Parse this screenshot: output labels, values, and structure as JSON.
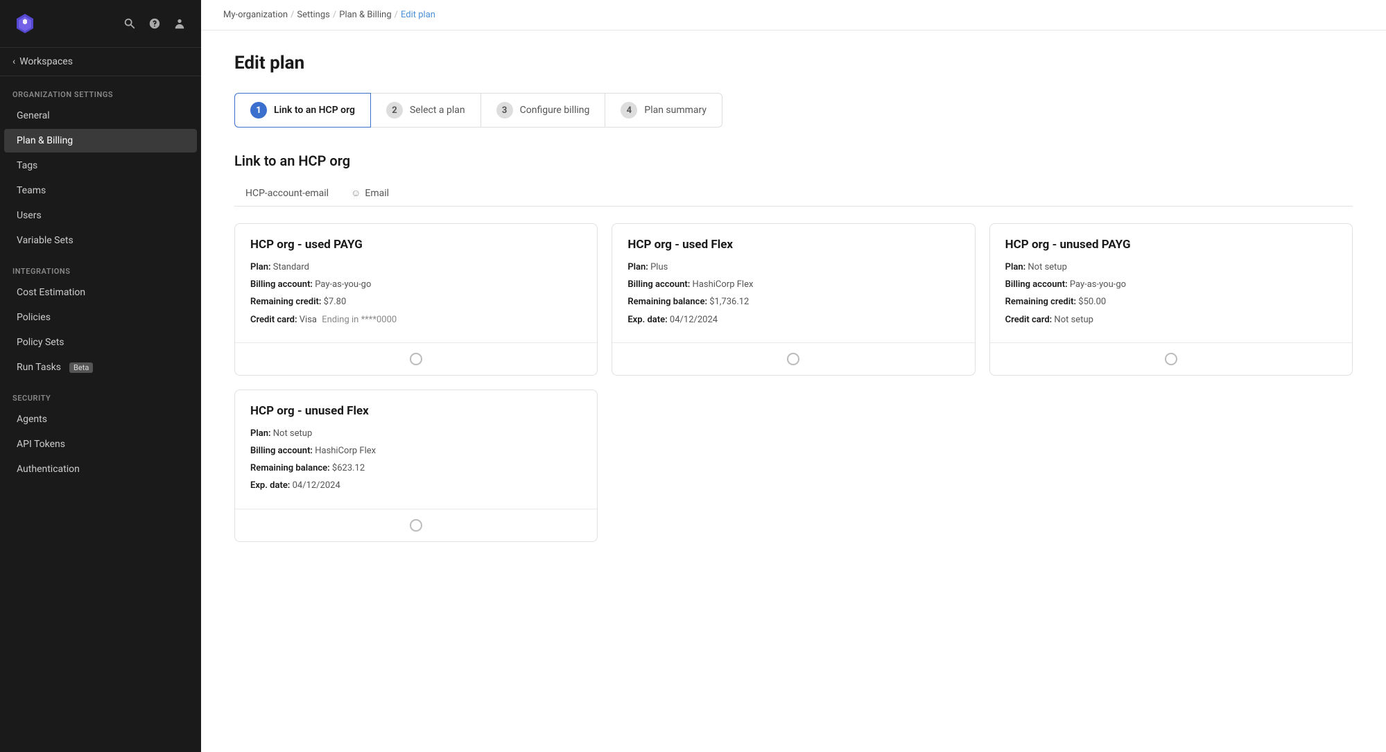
{
  "sidebar": {
    "workspaces_label": "Workspaces",
    "org_settings_label": "Organization Settings",
    "integrations_label": "Integrations",
    "security_label": "Security",
    "items_org": [
      {
        "id": "general",
        "label": "General",
        "active": false
      },
      {
        "id": "plan-billing",
        "label": "Plan & Billing",
        "active": true
      },
      {
        "id": "tags",
        "label": "Tags",
        "active": false
      },
      {
        "id": "teams",
        "label": "Teams",
        "active": false
      },
      {
        "id": "users",
        "label": "Users",
        "active": false
      },
      {
        "id": "variable-sets",
        "label": "Variable Sets",
        "active": false
      }
    ],
    "items_integrations": [
      {
        "id": "cost-estimation",
        "label": "Cost Estimation",
        "active": false
      },
      {
        "id": "policies",
        "label": "Policies",
        "active": false
      },
      {
        "id": "policy-sets",
        "label": "Policy Sets",
        "active": false
      },
      {
        "id": "run-tasks",
        "label": "Run Tasks",
        "active": false,
        "badge": "Beta"
      }
    ],
    "items_security": [
      {
        "id": "agents",
        "label": "Agents",
        "active": false
      },
      {
        "id": "api-tokens",
        "label": "API Tokens",
        "active": false
      },
      {
        "id": "authentication",
        "label": "Authentication",
        "active": false
      }
    ]
  },
  "breadcrumb": {
    "org": "My-organization",
    "settings": "Settings",
    "plan_billing": "Plan & Billing",
    "current": "Edit plan"
  },
  "page": {
    "title": "Edit plan",
    "steps": [
      {
        "number": "1",
        "label": "Link to an HCP org",
        "active": true
      },
      {
        "number": "2",
        "label": "Select a plan",
        "active": false
      },
      {
        "number": "3",
        "label": "Configure billing",
        "active": false
      },
      {
        "number": "4",
        "label": "Plan summary",
        "active": false
      }
    ],
    "section_title": "Link to an HCP org",
    "tab_email_label": "Email",
    "tab_hcp_account": "HCP-account-email",
    "cards": [
      {
        "id": "card1",
        "title": "HCP org -  used PAYG",
        "plan_label": "Plan:",
        "plan_value": "Standard",
        "billing_label": "Billing account:",
        "billing_value": "Pay-as-you-go",
        "remaining_label": "Remaining credit:",
        "remaining_value": "$7.80",
        "extra_label": "Credit card:",
        "extra_value": "Visa",
        "extra_detail": "Ending in ****0000"
      },
      {
        "id": "card2",
        "title": "HCP org -  used Flex",
        "plan_label": "Plan:",
        "plan_value": "Plus",
        "billing_label": "Billing account:",
        "billing_value": "HashiCorp Flex",
        "remaining_label": "Remaining balance:",
        "remaining_value": "$1,736.12",
        "extra_label": "Exp. date:",
        "extra_value": "04/12/2024",
        "extra_detail": ""
      },
      {
        "id": "card3",
        "title": "HCP org - unused PAYG",
        "plan_label": "Plan:",
        "plan_value": "Not setup",
        "billing_label": "Billing account:",
        "billing_value": "Pay-as-you-go",
        "remaining_label": "Remaining credit:",
        "remaining_value": "$50.00",
        "extra_label": "Credit card:",
        "extra_value": "Not setup",
        "extra_detail": ""
      },
      {
        "id": "card4",
        "title": "HCP org - unused Flex",
        "plan_label": "Plan:",
        "plan_value": "Not setup",
        "billing_label": "Billing account:",
        "billing_value": "HashiCorp Flex",
        "remaining_label": "Remaining balance:",
        "remaining_value": "$623.12",
        "extra_label": "Exp. date:",
        "extra_value": "04/12/2024",
        "extra_detail": ""
      }
    ]
  }
}
